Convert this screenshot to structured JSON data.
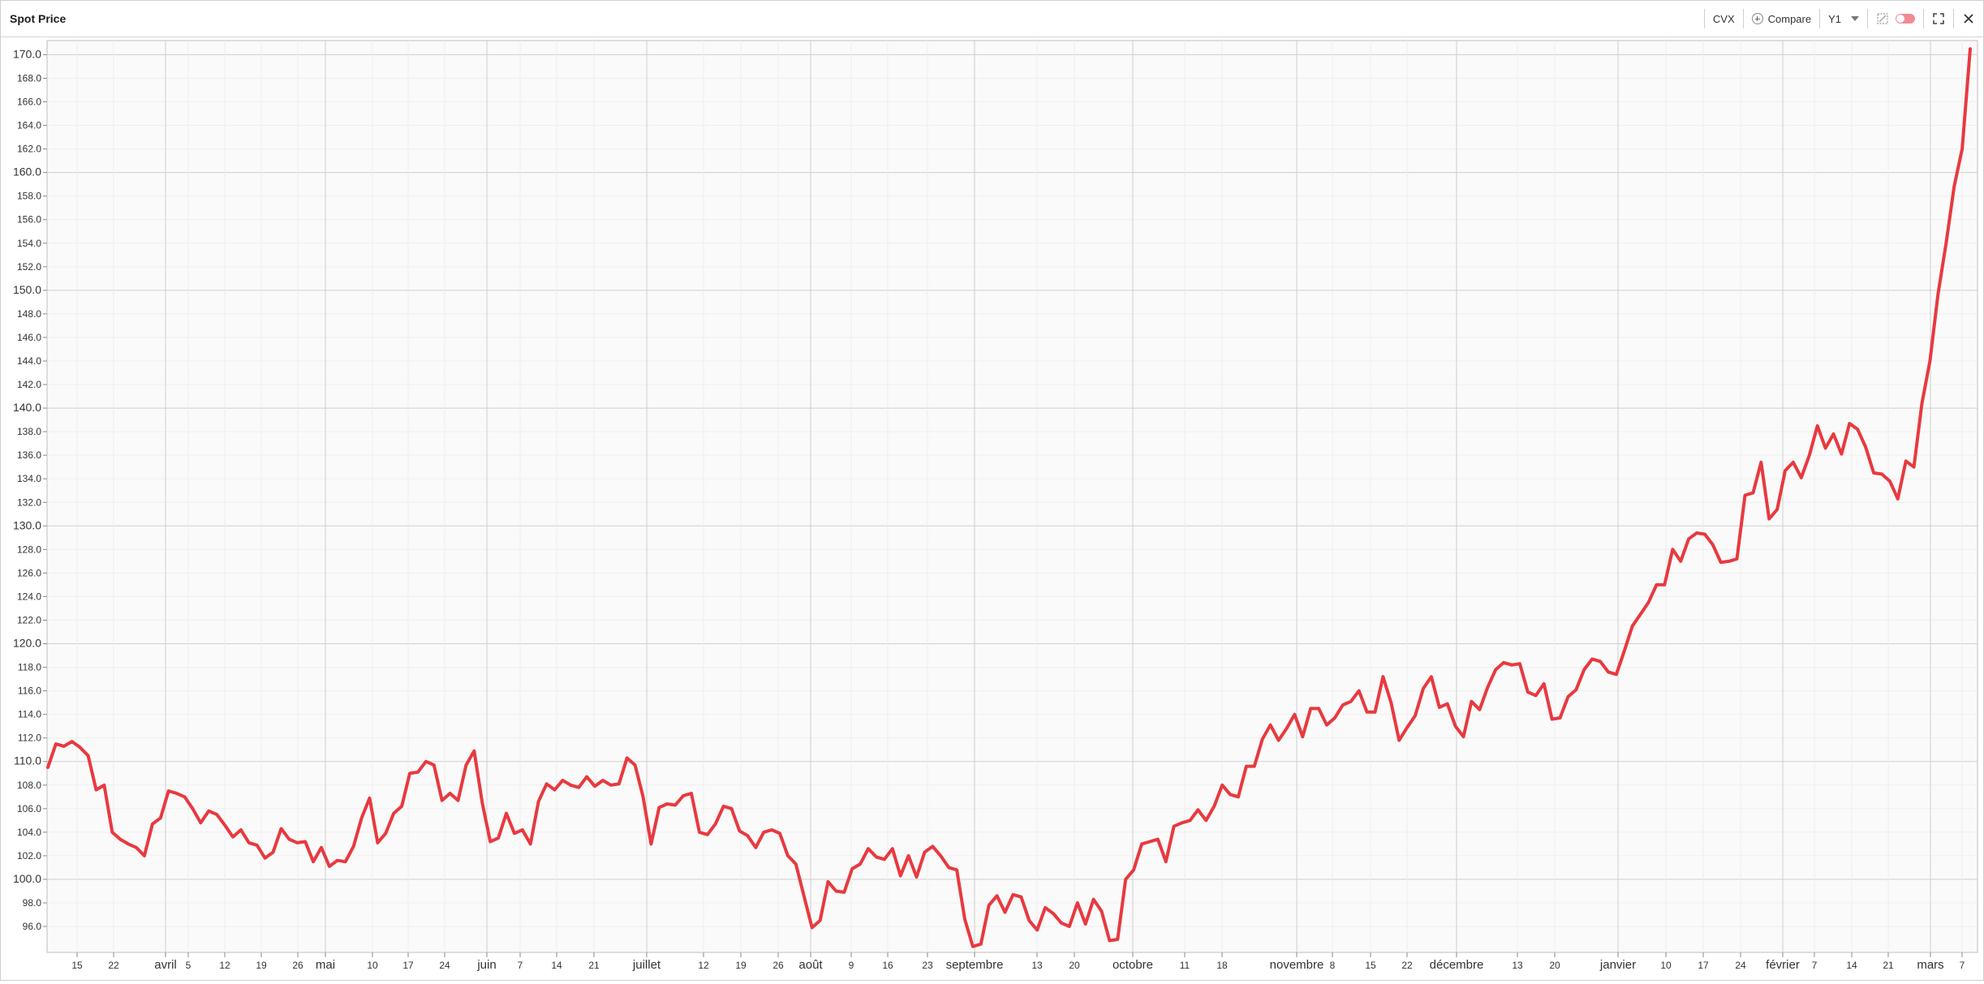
{
  "window": {
    "title": "Spot Price"
  },
  "toolbar": {
    "ticker": "CVX",
    "compare_label": "Compare",
    "period": "Y1"
  },
  "colors": {
    "line": "#e8393f",
    "grid_major": "#cfcfcf",
    "grid_minor": "#eeeeee"
  },
  "chart_data": {
    "type": "line",
    "title": "Spot Price",
    "xlabel": "",
    "ylabel": "",
    "ylim": [
      94,
      171
    ],
    "yticks_major": [
      100,
      110,
      120,
      130,
      140,
      150,
      160,
      170
    ],
    "grid": true,
    "x_tick_labels": [
      {
        "label": "15",
        "major": false
      },
      {
        "label": "22",
        "major": false
      },
      {
        "label": "avril",
        "major": true
      },
      {
        "label": "5",
        "major": false
      },
      {
        "label": "12",
        "major": false
      },
      {
        "label": "19",
        "major": false
      },
      {
        "label": "26",
        "major": false
      },
      {
        "label": "mai",
        "major": true
      },
      {
        "label": "10",
        "major": false
      },
      {
        "label": "17",
        "major": false
      },
      {
        "label": "24",
        "major": false
      },
      {
        "label": "juin",
        "major": true
      },
      {
        "label": "7",
        "major": false
      },
      {
        "label": "14",
        "major": false
      },
      {
        "label": "21",
        "major": false
      },
      {
        "label": "juillet",
        "major": true
      },
      {
        "label": "12",
        "major": false
      },
      {
        "label": "19",
        "major": false
      },
      {
        "label": "26",
        "major": false
      },
      {
        "label": "août",
        "major": true
      },
      {
        "label": "9",
        "major": false
      },
      {
        "label": "16",
        "major": false
      },
      {
        "label": "23",
        "major": false
      },
      {
        "label": "septembre",
        "major": true
      },
      {
        "label": "13",
        "major": false
      },
      {
        "label": "20",
        "major": false
      },
      {
        "label": "octobre",
        "major": true
      },
      {
        "label": "11",
        "major": false
      },
      {
        "label": "18",
        "major": false
      },
      {
        "label": "novembre",
        "major": true
      },
      {
        "label": "8",
        "major": false
      },
      {
        "label": "15",
        "major": false
      },
      {
        "label": "22",
        "major": false
      },
      {
        "label": "décembre",
        "major": true
      },
      {
        "label": "13",
        "major": false
      },
      {
        "label": "20",
        "major": false
      },
      {
        "label": "janvier",
        "major": true
      },
      {
        "label": "10",
        "major": false
      },
      {
        "label": "17",
        "major": false
      },
      {
        "label": "24",
        "major": false
      },
      {
        "label": "février",
        "major": true
      },
      {
        "label": "7",
        "major": false
      },
      {
        "label": "14",
        "major": false
      },
      {
        "label": "21",
        "major": false
      },
      {
        "label": "mars",
        "major": true
      },
      {
        "label": "7",
        "major": false
      }
    ],
    "series": [
      {
        "values": [
          109.5,
          111.5,
          111.3,
          111.7,
          111.2,
          110.5,
          107.6,
          108.0,
          104.0,
          103.4,
          103.0,
          102.7,
          102.0,
          104.7,
          105.2,
          107.5,
          107.3,
          107.0,
          106.0,
          104.8,
          105.8,
          105.5,
          104.6,
          103.6,
          104.2,
          103.1,
          102.9,
          101.8,
          102.3,
          104.3,
          103.4,
          103.1,
          103.2,
          101.5,
          102.7,
          101.1,
          101.6,
          101.5,
          102.8,
          105.2,
          106.9,
          103.1,
          103.9,
          105.6,
          106.2,
          109.0,
          109.1,
          110.0,
          109.7,
          106.7,
          107.3,
          106.7,
          109.7,
          110.9,
          106.5,
          103.2,
          103.5,
          105.6,
          103.9,
          104.2,
          103.0,
          106.6,
          108.1,
          107.6,
          108.4,
          108.0,
          107.8,
          108.7,
          107.9,
          108.4,
          108.0,
          108.1,
          110.3,
          109.7,
          107.0,
          103.0,
          106.1,
          106.4,
          106.3,
          107.1,
          107.3,
          104.0,
          103.8,
          104.7,
          106.2,
          106.0,
          104.1,
          103.7,
          102.7,
          104.0,
          104.2,
          103.9,
          102.0,
          101.3,
          98.6,
          95.9,
          96.5,
          99.8,
          99.0,
          98.9,
          100.9,
          101.3,
          102.6,
          101.9,
          101.7,
          102.6,
          100.3,
          102.0,
          100.2,
          102.3,
          102.8,
          102.0,
          101.0,
          100.8,
          96.6,
          94.3,
          94.5,
          97.8,
          98.6,
          97.2,
          98.7,
          98.5,
          96.5,
          95.7,
          97.6,
          97.1,
          96.3,
          96.0,
          98.0,
          96.2,
          98.3,
          97.3,
          94.8,
          94.9,
          100.0,
          100.8,
          103.0,
          103.2,
          103.4,
          101.5,
          104.5,
          104.8,
          105.0,
          105.9,
          105.0,
          106.2,
          108.0,
          107.2,
          107.0,
          109.6,
          109.6,
          111.9,
          113.1,
          111.8,
          112.8,
          114.0,
          112.1,
          114.5,
          114.5,
          113.1,
          113.7,
          114.8,
          115.1,
          116.0,
          114.2,
          114.2,
          117.2,
          115.0,
          111.8,
          112.9,
          113.9,
          116.2,
          117.2,
          114.6,
          114.9,
          113.0,
          112.1,
          115.1,
          114.4,
          116.3,
          117.8,
          118.4,
          118.2,
          118.3,
          115.9,
          115.6,
          116.6,
          113.6,
          113.7,
          115.5,
          116.1,
          117.8,
          118.7,
          118.5,
          117.6,
          117.4,
          119.4,
          121.5,
          122.5,
          123.5,
          125.0,
          125.0,
          128.0,
          127.0,
          128.9,
          129.4,
          129.3,
          128.4,
          126.9,
          127.0,
          127.2,
          132.6,
          132.8,
          135.4,
          130.6,
          131.4,
          134.7,
          135.4,
          134.1,
          136.0,
          138.5,
          136.6,
          137.8,
          136.1,
          138.7,
          138.2,
          136.7,
          134.5,
          134.4,
          133.8,
          132.3,
          135.5,
          135.0,
          140.4,
          144.0,
          149.7,
          154.0,
          158.8,
          162.0,
          170.5
        ]
      }
    ]
  }
}
